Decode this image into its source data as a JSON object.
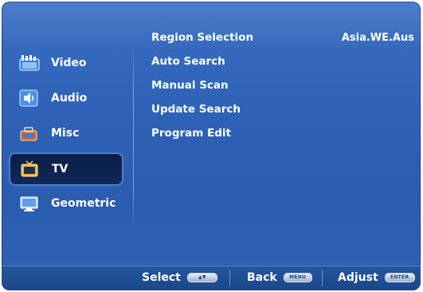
{
  "sidebar": {
    "items": [
      {
        "label": "Video",
        "icon": "video-icon",
        "selected": false
      },
      {
        "label": "Audio",
        "icon": "audio-icon",
        "selected": false
      },
      {
        "label": "Misc",
        "icon": "misc-icon",
        "selected": false
      },
      {
        "label": "TV",
        "icon": "tv-icon",
        "selected": true
      },
      {
        "label": "Geometric",
        "icon": "geometric-icon",
        "selected": false
      }
    ]
  },
  "menu": {
    "items": [
      {
        "label": "Region Selection",
        "value": "Asia.WE.Aus"
      },
      {
        "label": "Auto Search",
        "value": ""
      },
      {
        "label": "Manual Scan",
        "value": ""
      },
      {
        "label": "Update Search",
        "value": ""
      },
      {
        "label": "Program Edit",
        "value": ""
      }
    ]
  },
  "footer": {
    "select_label": "Select",
    "select_key": "▲▼",
    "back_label": "Back",
    "back_key": "MENU",
    "adjust_label": "Adjust",
    "adjust_key": "ENTER"
  },
  "colors": {
    "background": "#2f63b8",
    "selected_bg": "#0e2452",
    "text": "#ffffff"
  }
}
